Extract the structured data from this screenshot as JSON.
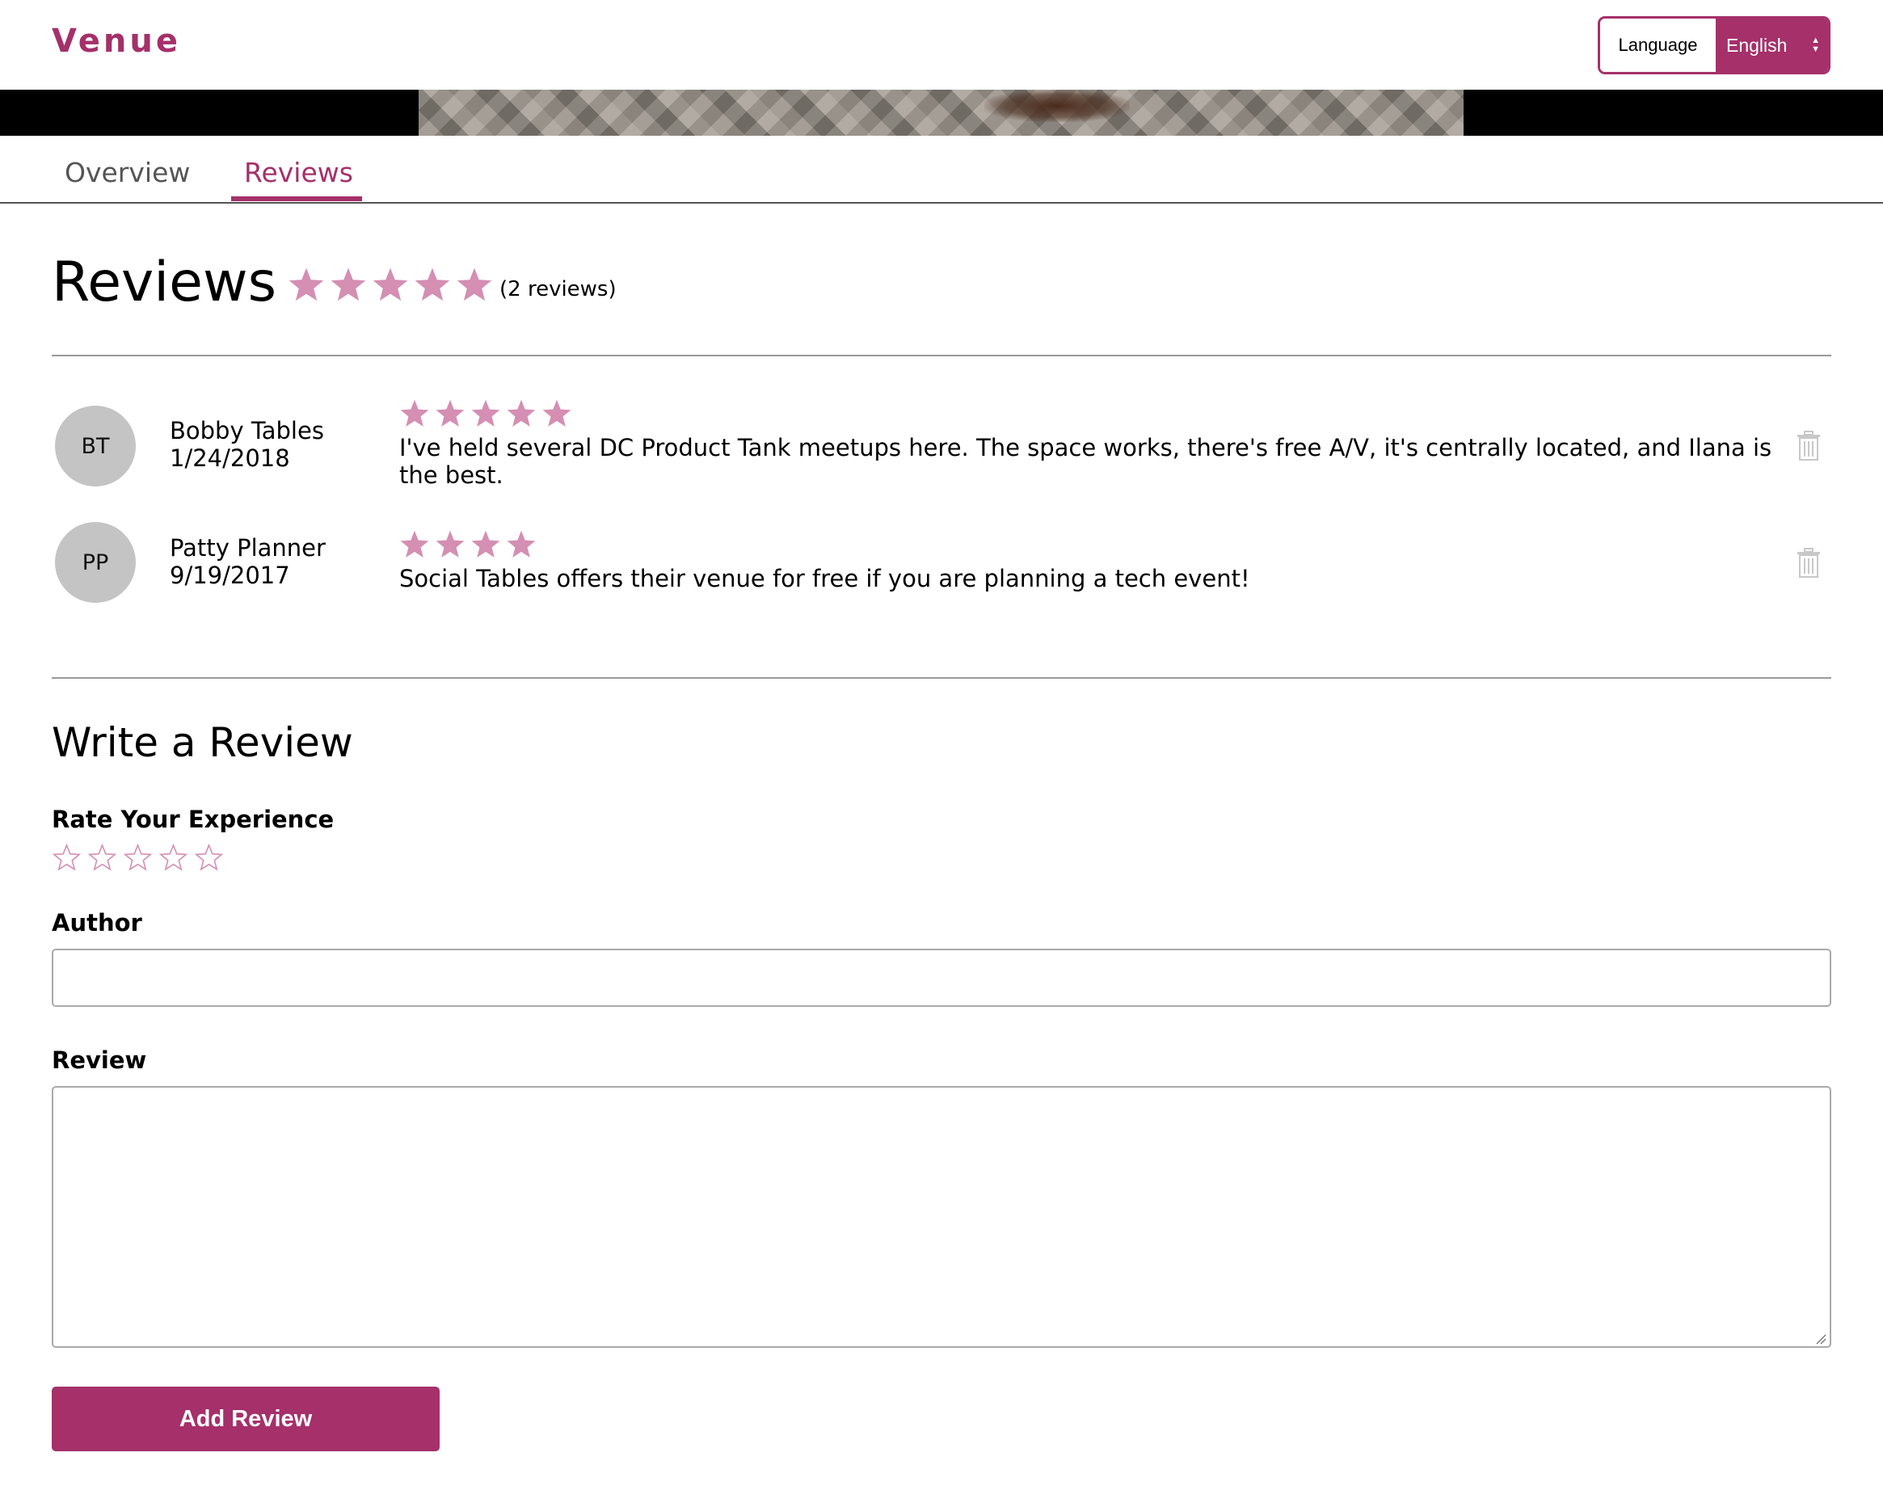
{
  "header": {
    "brand": "Venue",
    "language_label": "Language",
    "language_value": "English"
  },
  "tabs": [
    {
      "label": "Overview",
      "active": false
    },
    {
      "label": "Reviews",
      "active": true
    }
  ],
  "reviews_section": {
    "title": "Reviews",
    "average_rating": 5,
    "count_text": "(2 reviews)",
    "items": [
      {
        "initials": "BT",
        "author": "Bobby Tables",
        "date": "1/24/2018",
        "rating": 5,
        "text": "I've held several DC Product Tank meetups here. The space works, there's free A/V, it's centrally located, and Ilana is the best."
      },
      {
        "initials": "PP",
        "author": "Patty Planner",
        "date": "9/19/2017",
        "rating": 4,
        "text": "Social Tables offers their venue for free if you are planning a tech event!"
      }
    ]
  },
  "write_review": {
    "title": "Write a Review",
    "rate_label": "Rate Your Experience",
    "rating": 0,
    "author_label": "Author",
    "author_value": "",
    "review_label": "Review",
    "review_value": "",
    "submit_label": "Add Review"
  },
  "colors": {
    "accent": "#a5306a",
    "star_filled": "#d48fb3",
    "star_outline": "#d48fb3"
  },
  "icons": {
    "star": "star-icon",
    "trash": "trash-icon",
    "select_arrows": "updown-arrows-icon"
  }
}
